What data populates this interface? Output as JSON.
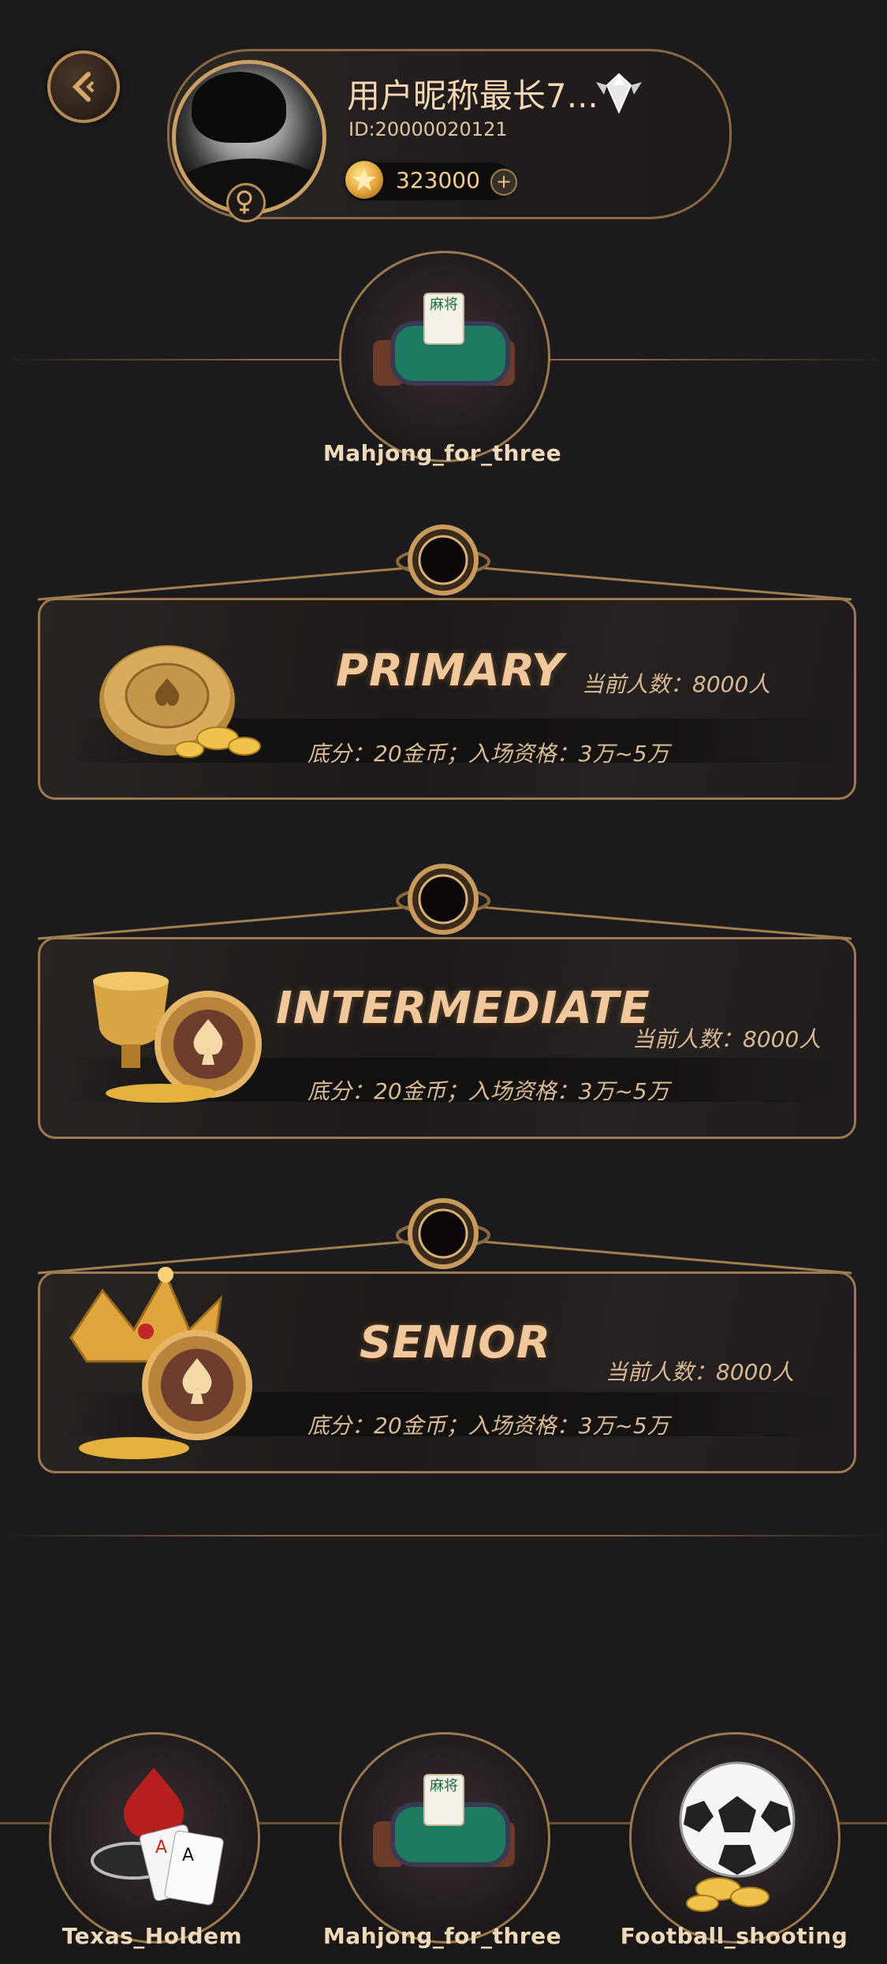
{
  "header": {
    "back_icon": "chevron-left-icon",
    "username": "用户昵称最长7...",
    "vip_icon": "diamond-badge-icon",
    "user_id": "ID:2000002​0121",
    "gender_icon": "female-symbol-icon",
    "coin_icon": "gold-coin-star-icon",
    "coins": "323000",
    "add_icon": "plus-icon"
  },
  "current_game": {
    "label": "Mahjong_for_three",
    "tile_text": "麻将",
    "icon": "mahjong-table-icon"
  },
  "levels": [
    {
      "title": "PRIMARY",
      "players": "当前人数：8000人",
      "stake": "底分：20金币；入场资格：3万~5万",
      "icon": "poker-chip-coins-icon"
    },
    {
      "title": "INTERMEDIATE",
      "players": "当前人数：8000人",
      "stake": "底分：20金币；入场资格：3万~5万",
      "icon": "trophy-chip-icon"
    },
    {
      "title": "SENIOR",
      "players": "当前人数：8000人",
      "stake": "底分：20金币；入场资格：3万~5万",
      "icon": "crown-chip-icon"
    }
  ],
  "bottom_nav": [
    {
      "label": "Texas_Holdem",
      "icon": "playing-cards-icon"
    },
    {
      "label": "Mahjong_for_three",
      "icon": "mahjong-table-icon"
    },
    {
      "label": "Football_shooting",
      "icon": "soccer-ball-icon"
    }
  ],
  "colors": {
    "background": "#1d1b1e",
    "gold": "#b58a55",
    "text_gold": "#f1c79c"
  }
}
